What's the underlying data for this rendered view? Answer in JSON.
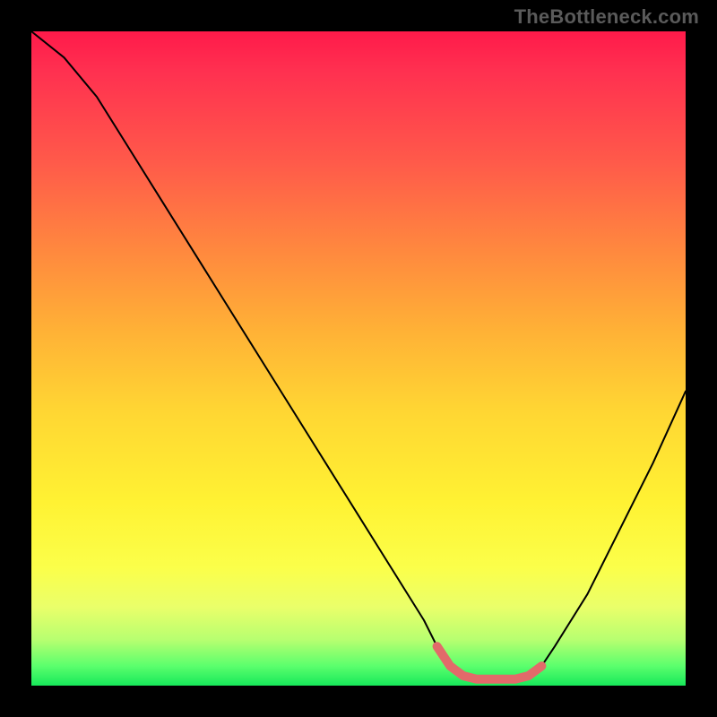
{
  "watermark": "TheBottleneck.com",
  "chart_data": {
    "type": "line",
    "title": "",
    "xlabel": "",
    "ylabel": "",
    "xlim": [
      0,
      100
    ],
    "ylim": [
      0,
      100
    ],
    "series": [
      {
        "name": "bottleneck-curve",
        "color": "#000000",
        "x": [
          0,
          5,
          10,
          15,
          20,
          25,
          30,
          35,
          40,
          45,
          50,
          55,
          60,
          62,
          64,
          66,
          68,
          70,
          72,
          74,
          76,
          78,
          80,
          85,
          90,
          95,
          100
        ],
        "y": [
          100,
          96,
          90,
          82,
          74,
          66,
          58,
          50,
          42,
          34,
          26,
          18,
          10,
          6,
          3,
          1.5,
          1,
          1,
          1,
          1,
          1.5,
          3,
          6,
          14,
          24,
          34,
          45
        ]
      },
      {
        "name": "optimal-range-marker",
        "color": "#e26a6a",
        "x": [
          62,
          64,
          66,
          68,
          70,
          72,
          74,
          76,
          78
        ],
        "y": [
          6,
          3,
          1.5,
          1,
          1,
          1,
          1,
          1.5,
          3
        ]
      }
    ]
  }
}
